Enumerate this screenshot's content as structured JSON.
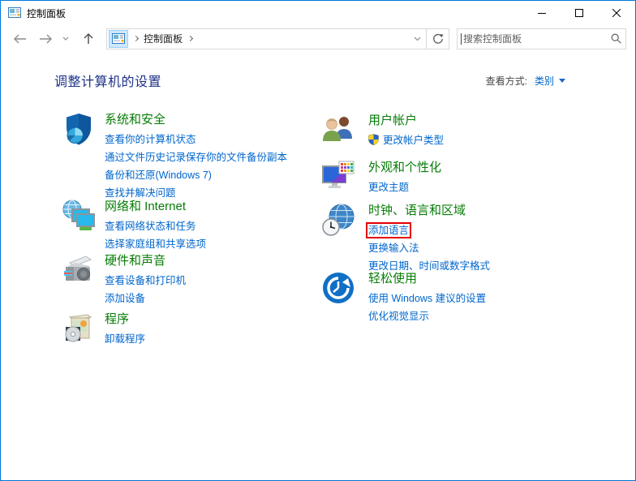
{
  "window": {
    "title": "控制面板"
  },
  "toolbar": {
    "breadcrumb": {
      "root_label": "控制面板"
    },
    "search": {
      "placeholder": "搜索控制面板"
    }
  },
  "page": {
    "heading": "调整计算机的设置",
    "view_by_label": "查看方式:",
    "view_by_value": "类别"
  },
  "sections": {
    "system_security": {
      "title": "系统和安全",
      "links": [
        "查看你的计算机状态",
        "通过文件历史记录保存你的文件备份副本",
        "备份和还原(Windows 7)",
        "查找并解决问题"
      ]
    },
    "network_internet": {
      "title": "网络和 Internet",
      "links": [
        "查看网络状态和任务",
        "选择家庭组和共享选项"
      ]
    },
    "hardware_sound": {
      "title": "硬件和声音",
      "links": [
        "查看设备和打印机",
        "添加设备"
      ]
    },
    "programs": {
      "title": "程序",
      "links": [
        "卸载程序"
      ]
    },
    "user_accounts": {
      "title": "用户帐户",
      "links": [
        {
          "label": "更改帐户类型",
          "uac_shield": true
        }
      ]
    },
    "appearance_personalization": {
      "title": "外观和个性化",
      "links": [
        "更改主题"
      ]
    },
    "clock_language_region": {
      "title": "时钟、语言和区域",
      "links": [
        {
          "label": "添加语言",
          "highlighted": true
        },
        "更换输入法",
        "更改日期、时间或数字格式"
      ]
    },
    "ease_of_access": {
      "title": "轻松使用",
      "links": [
        "使用 Windows 建议的设置",
        "优化视觉显示"
      ]
    }
  },
  "icons": {
    "control-panel-icon": "app glyph",
    "back-icon": "←",
    "forward-icon": "→",
    "history-chevron-icon": "⌄",
    "up-icon": "↑",
    "refresh-icon": "↻",
    "search-icon": "magnifier",
    "dropdown-icon": "▼",
    "uac-shield-icon": "shield",
    "minimize-icon": "–",
    "maximize-icon": "□",
    "close-icon": "✕"
  },
  "colors": {
    "window_border": "#0078d7",
    "category_title": "#067d06",
    "task_link": "#0066cc",
    "page_heading": "#1d3287",
    "highlight_box": "#e40000"
  }
}
